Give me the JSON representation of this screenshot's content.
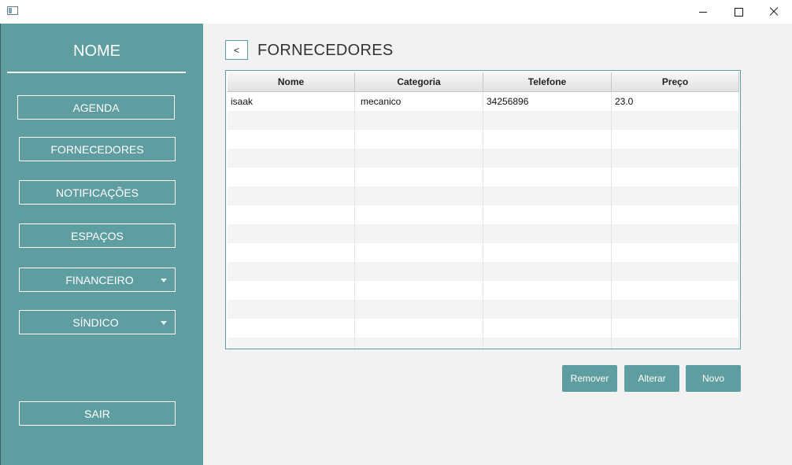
{
  "window": {
    "icons": {
      "app": "app-icon",
      "minimize": "minimize-icon",
      "maximize": "maximize-icon",
      "close": "close-icon"
    }
  },
  "sidebar": {
    "title": "NOME",
    "items": [
      {
        "label": "AGENDA",
        "dropdown": false
      },
      {
        "label": "FORNECEDORES",
        "dropdown": false
      },
      {
        "label": "NOTIFICAÇÕES",
        "dropdown": false
      },
      {
        "label": "ESPAÇOS",
        "dropdown": false
      },
      {
        "label": "FINANCEIRO",
        "dropdown": true
      },
      {
        "label": "SÍNDICO",
        "dropdown": true
      }
    ],
    "logout_label": "SAIR",
    "background_color": "#5f9ea0"
  },
  "header": {
    "back_label": "<",
    "title": "FORNECEDORES"
  },
  "table": {
    "columns": [
      "Nome",
      "Categoria",
      "Telefone",
      "Preço"
    ],
    "rows": [
      [
        "isaak",
        "mecanico",
        "34256896",
        "23.0"
      ]
    ]
  },
  "actions": {
    "remove_label": "Remover",
    "edit_label": "Alterar",
    "new_label": "Novo"
  },
  "colors": {
    "accent": "#5f9ea0"
  }
}
